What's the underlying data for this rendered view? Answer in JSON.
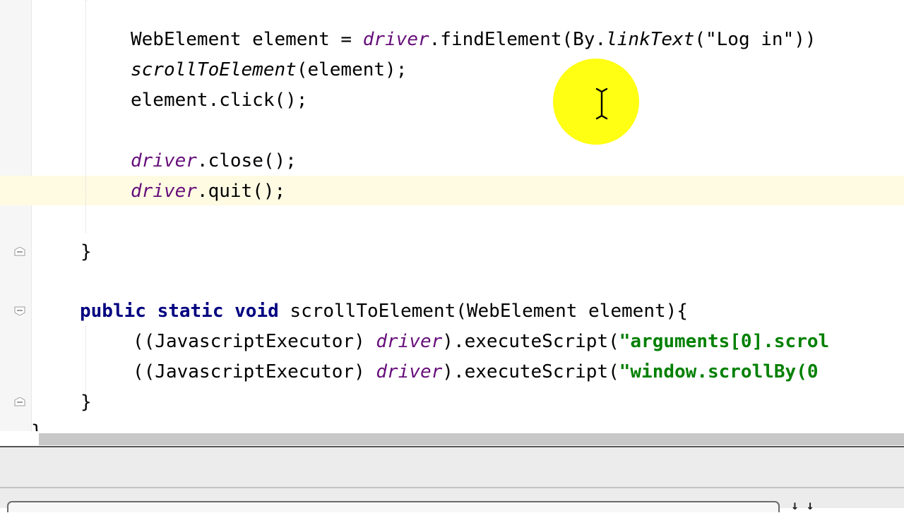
{
  "editor": {
    "lines": [
      {
        "id": "webelement-line",
        "tokens": [
          {
            "t": "WebElement element = ",
            "c": ""
          },
          {
            "t": "driver",
            "c": "field"
          },
          {
            "t": ".findElement(By.",
            "c": ""
          },
          {
            "t": "linkText",
            "c": "it"
          },
          {
            "t": "(\"Log in\"))",
            "c": ""
          }
        ]
      },
      {
        "id": "scroll-call-line",
        "tokens": [
          {
            "t": "scrollToElement",
            "c": "it"
          },
          {
            "t": "(element);",
            "c": ""
          }
        ]
      },
      {
        "id": "click-line",
        "tokens": [
          {
            "t": "element.click();",
            "c": ""
          }
        ]
      },
      {
        "id": "close-line",
        "tokens": [
          {
            "t": "driver",
            "c": "field"
          },
          {
            "t": ".close();",
            "c": ""
          }
        ]
      },
      {
        "id": "quit-line",
        "tokens": [
          {
            "t": "driver",
            "c": "field"
          },
          {
            "t": ".quit();",
            "c": ""
          }
        ]
      },
      {
        "id": "main-close-brace",
        "tokens": [
          {
            "t": "}",
            "c": ""
          }
        ]
      },
      {
        "id": "method-signature",
        "tokens": [
          {
            "t": "public static void",
            "c": "kw"
          },
          {
            "t": " scrollToElement(WebElement element){",
            "c": ""
          }
        ]
      },
      {
        "id": "exec-scroll-into-view",
        "tokens": [
          {
            "t": "((JavascriptExecutor) ",
            "c": ""
          },
          {
            "t": "driver",
            "c": "field"
          },
          {
            "t": ").executeScript(",
            "c": ""
          },
          {
            "t": "\"arguments[0].scrol",
            "c": "str"
          }
        ]
      },
      {
        "id": "exec-scroll-by",
        "tokens": [
          {
            "t": "((JavascriptExecutor) ",
            "c": ""
          },
          {
            "t": "driver",
            "c": "field"
          },
          {
            "t": ").executeScript(",
            "c": ""
          },
          {
            "t": "\"window.scrollBy(0",
            "c": "str"
          }
        ]
      },
      {
        "id": "method-close-brace",
        "tokens": [
          {
            "t": "}",
            "c": ""
          }
        ]
      },
      {
        "id": "class-close-brace",
        "tokens": [
          {
            "t": "}",
            "c": ""
          }
        ]
      }
    ]
  },
  "colors": {
    "field": "#660e7a",
    "string": "#008000",
    "keyword": "#000080",
    "caret_line": "#fffbe3",
    "cursor_highlight": "#ffff00"
  },
  "bottom_panel": {
    "right_glyph": "↓ ↓"
  }
}
